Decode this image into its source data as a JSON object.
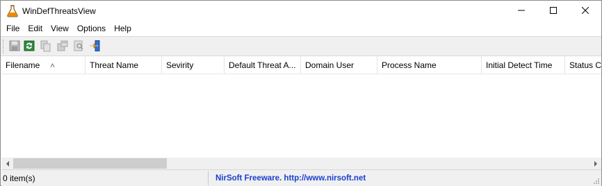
{
  "window": {
    "title": "WinDefThreatsView",
    "app_icon": "flask-icon",
    "controls": {
      "minimize": "minimize-icon",
      "maximize": "maximize-icon",
      "close": "close-icon"
    }
  },
  "menu": {
    "items": [
      "File",
      "Edit",
      "View",
      "Options",
      "Help"
    ]
  },
  "toolbar": {
    "buttons": [
      {
        "icon": "save-icon",
        "enabled": false
      },
      {
        "icon": "refresh-icon",
        "enabled": true
      },
      {
        "icon": "copy-icon",
        "enabled": false
      },
      {
        "icon": "properties-icon",
        "enabled": false
      },
      {
        "icon": "find-icon",
        "enabled": false
      },
      {
        "icon": "exit-icon",
        "enabled": true
      }
    ]
  },
  "list": {
    "columns": [
      "Filename",
      "Threat Name",
      "Sevirity",
      "Default Threat A...",
      "Domain User",
      "Process Name",
      "Initial Detect Time",
      "Status Ch"
    ],
    "sorted_column": "Filename",
    "sort_direction": "ascending",
    "rows": []
  },
  "status": {
    "items": "0 item(s)",
    "link": "NirSoft Freeware.  http://www.nirsoft.net"
  },
  "colors": {
    "link": "#1a3fd0",
    "chrome": "#f0f0f0",
    "scroll_thumb": "#cdcdcd"
  }
}
